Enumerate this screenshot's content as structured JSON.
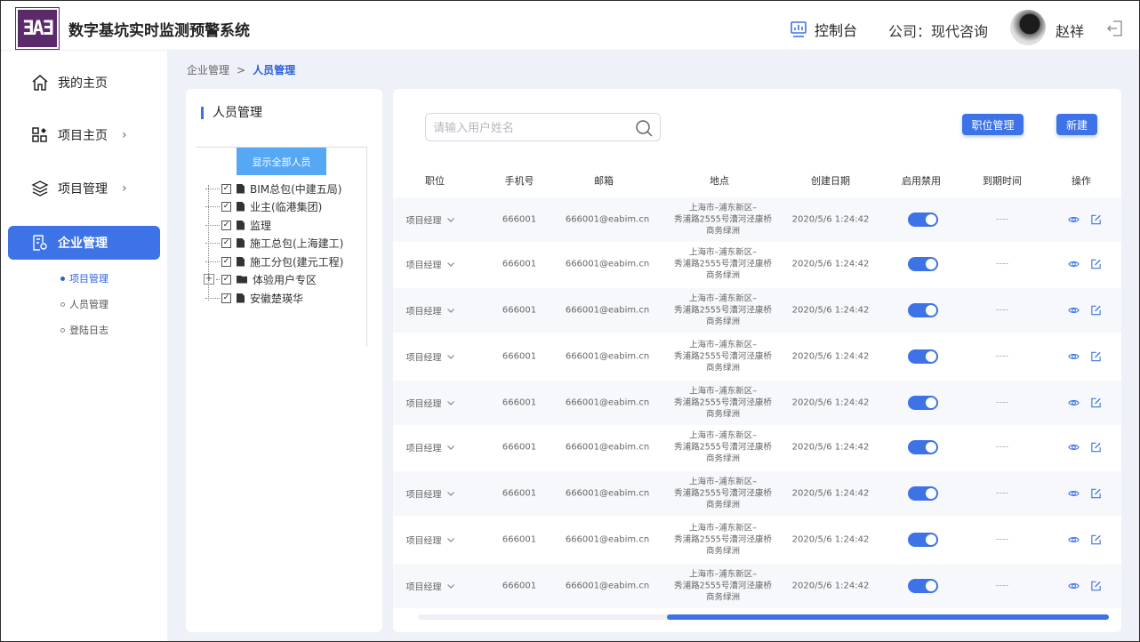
{
  "header": {
    "logo_text": "ƎAƎ",
    "app_title": "数字基坑实时监测预警系统",
    "console_label": "控制台",
    "company": "公司：现代咨询",
    "username": "赵祥"
  },
  "sidebar": {
    "items": [
      {
        "label": "我的主页",
        "icon": "home-icon"
      },
      {
        "label": "项目主页",
        "icon": "apps-icon",
        "chevron": "›"
      },
      {
        "label": "项目管理",
        "icon": "layers-icon",
        "chevron": "›"
      },
      {
        "label": "企业管理",
        "icon": "enterprise-icon",
        "active": true
      }
    ],
    "sub_items": [
      {
        "label": "项目管理",
        "active": true
      },
      {
        "label": "人员管理"
      },
      {
        "label": "登陆日志"
      }
    ]
  },
  "breadcrumb": {
    "parent": "企业管理",
    "separator": ">",
    "current": "人员管理"
  },
  "left_panel": {
    "title": "人员管理",
    "show_all_label": "显示全部人员",
    "tree": [
      {
        "label": "BIM总包(中建五局)",
        "type": "doc"
      },
      {
        "label": "业主(临港集团)",
        "type": "doc"
      },
      {
        "label": "监理",
        "type": "doc"
      },
      {
        "label": "施工总包(上海建工)",
        "type": "doc"
      },
      {
        "label": "施工分包(建元工程)",
        "type": "doc"
      },
      {
        "label": "体验用户专区",
        "type": "folder",
        "expander": "+"
      },
      {
        "label": "安徽楚瑛华",
        "type": "doc"
      }
    ]
  },
  "right_panel": {
    "search_placeholder": "请输入用户姓名",
    "btn_position": "职位管理",
    "btn_new": "新建",
    "columns": [
      "职位",
      "手机号",
      "邮箱",
      "地点",
      "创建日期",
      "启用禁用",
      "到期时间",
      "操作"
    ],
    "rows": [
      {
        "position": "项目经理",
        "phone": "666001",
        "email": "666001@eabim.cn",
        "addr1": "上海市–浦东新区–",
        "addr2": "秀浦路2555号漕河泾康桥",
        "addr3": "商务绿洲",
        "created": "2020/5/6 1:24:42",
        "enabled": true,
        "expire": "----"
      },
      {
        "position": "项目经理",
        "phone": "666001",
        "email": "666001@eabim.cn",
        "addr1": "上海市–浦东新区–",
        "addr2": "秀浦路2555号漕河泾康桥",
        "addr3": "商务绿洲",
        "created": "2020/5/6 1:24:42",
        "enabled": true,
        "expire": "----"
      },
      {
        "position": "项目经理",
        "phone": "666001",
        "email": "666001@eabim.cn",
        "addr1": "上海市–浦东新区–",
        "addr2": "秀浦路2555号漕河泾康桥",
        "addr3": "商务绿洲",
        "created": "2020/5/6 1:24:42",
        "enabled": true,
        "expire": "----"
      },
      {
        "position": "项目经理",
        "phone": "666001",
        "email": "666001@eabim.cn",
        "addr1": "上海市–浦东新区–",
        "addr2": "秀浦路2555号漕河泾康桥",
        "addr3": "商务绿洲",
        "created": "2020/5/6 1:24:42",
        "enabled": true,
        "expire": "----"
      },
      {
        "position": "项目经理",
        "phone": "666001",
        "email": "666001@eabim.cn",
        "addr1": "上海市–浦东新区–",
        "addr2": "秀浦路2555号漕河泾康桥",
        "addr3": "商务绿洲",
        "created": "2020/5/6 1:24:42",
        "enabled": true,
        "expire": "----"
      },
      {
        "position": "项目经理",
        "phone": "666001",
        "email": "666001@eabim.cn",
        "addr1": "上海市–浦东新区–",
        "addr2": "秀浦路2555号漕河泾康桥",
        "addr3": "商务绿洲",
        "created": "2020/5/6 1:24:42",
        "enabled": true,
        "expire": "----"
      },
      {
        "position": "项目经理",
        "phone": "666001",
        "email": "666001@eabim.cn",
        "addr1": "上海市–浦东新区–",
        "addr2": "秀浦路2555号漕河泾康桥",
        "addr3": "商务绿洲",
        "created": "2020/5/6 1:24:42",
        "enabled": true,
        "expire": "----"
      },
      {
        "position": "项目经理",
        "phone": "666001",
        "email": "666001@eabim.cn",
        "addr1": "上海市–浦东新区–",
        "addr2": "秀浦路2555号漕河泾康桥",
        "addr3": "商务绿洲",
        "created": "2020/5/6 1:24:42",
        "enabled": true,
        "expire": "----"
      },
      {
        "position": "项目经理",
        "phone": "666001",
        "email": "666001@eabim.cn",
        "addr1": "上海市–浦东新区–",
        "addr2": "秀浦路2555号漕河泾康桥",
        "addr3": "商务绿洲",
        "created": "2020/5/6 1:24:42",
        "enabled": true,
        "expire": "----"
      }
    ]
  },
  "colors": {
    "accent": "#3d73e6",
    "show_all_button": "#56a8f4",
    "logo": "#5b2a6b",
    "content_bg": "#eef1f8"
  }
}
